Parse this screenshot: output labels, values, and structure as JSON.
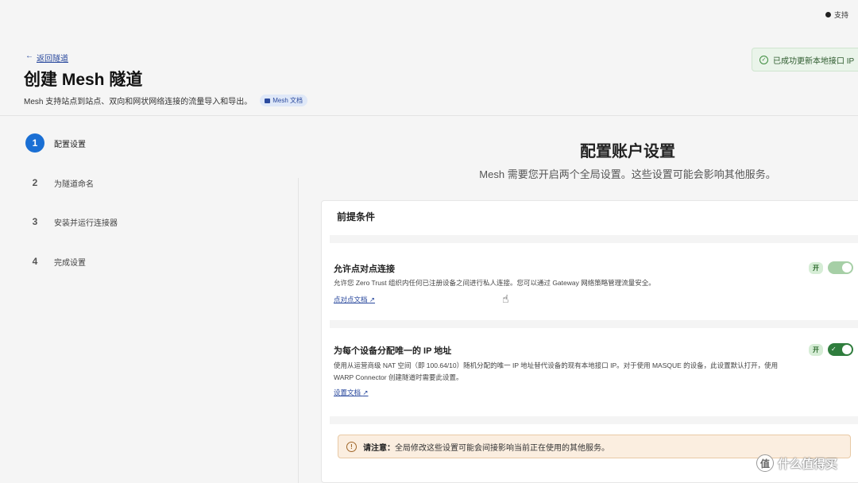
{
  "topbar": {
    "support_label": "支持",
    "support_icon": "dot-icon"
  },
  "toast": {
    "message": "已成功更新本地接口 IP",
    "icon": "check-circle-icon"
  },
  "header": {
    "back_label": "返回隧道",
    "back_arrow": "←",
    "title": "创建 Mesh 隧道",
    "description": "Mesh 支持站点到站点、双向和网状网络连接的流量导入和导出。",
    "doc_badge": "Mesh 文档"
  },
  "steps": [
    {
      "num": "1",
      "label": "配置设置",
      "active": true
    },
    {
      "num": "2",
      "label": "为隧道命名",
      "active": false
    },
    {
      "num": "3",
      "label": "安装并运行连接器",
      "active": false
    },
    {
      "num": "4",
      "label": "完成设置",
      "active": false
    }
  ],
  "main": {
    "title": "配置账户设置",
    "subtitle": "Mesh 需要您开启两个全局设置。这些设置可能会影响其他服务。",
    "card_heading": "前提条件"
  },
  "settings": [
    {
      "title": "允许点对点连接",
      "desc": "允许您 Zero Trust 组织内任何已注册设备之间进行私人连接。您可以通过 Gateway 网络策略管理流量安全。",
      "link": "点对点文档",
      "state_label": "开",
      "enabled": true
    },
    {
      "title": "为每个设备分配唯一的 IP 地址",
      "desc": "使用从运营商级 NAT 空间（即 100.64/10）随机分配的唯一 IP 地址替代设备的现有本地接口 IP。对于使用 MASQUE 的设备，此设置默认打开，使用 WARP Connector 创建隧道时需要此设置。",
      "link": "设置文档",
      "state_label": "开",
      "enabled": true
    }
  ],
  "warning": {
    "bold": "请注意：",
    "text": "全局修改这些设置可能会间接影响当前正在使用的其他服务。"
  },
  "watermark": {
    "text": "什么值得买",
    "icon_char": "值"
  },
  "colors": {
    "accent": "#1a6fd4",
    "toggle_on": "#2f7d3d",
    "toast_bg": "#eaf4ea",
    "warning_bg": "#fbeee0"
  }
}
